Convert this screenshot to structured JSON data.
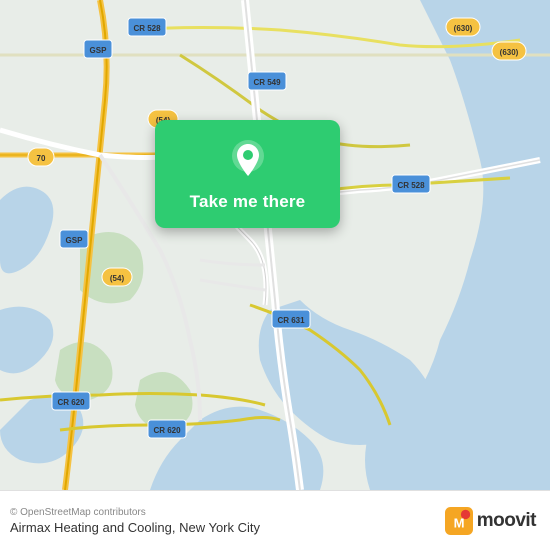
{
  "map": {
    "attribution": "© OpenStreetMap contributors",
    "background_color": "#e8f0e8"
  },
  "card": {
    "label": "Take me there",
    "background_color": "#2ecc71"
  },
  "bottom_bar": {
    "business_name": "Airmax Heating and Cooling, New York City",
    "moovit_text": "moovit"
  },
  "road_labels": [
    {
      "id": "cr528_top",
      "text": "CR 528"
    },
    {
      "id": "cr549",
      "text": "CR 549"
    },
    {
      "id": "cr630_1",
      "text": "(630)"
    },
    {
      "id": "cr630_2",
      "text": "(630)"
    },
    {
      "id": "gsp_top",
      "text": "GSP"
    },
    {
      "id": "54_top",
      "text": "(54)"
    },
    {
      "id": "70",
      "text": "70"
    },
    {
      "id": "gsp_mid",
      "text": "GSP"
    },
    {
      "id": "54_mid",
      "text": "(54)"
    },
    {
      "id": "cr528_mid",
      "text": "CR 528"
    },
    {
      "id": "cr631",
      "text": "CR 631"
    },
    {
      "id": "cr620_1",
      "text": "CR 620"
    },
    {
      "id": "cr620_2",
      "text": "CR 620"
    }
  ],
  "icons": {
    "location_pin": "location-pin-icon",
    "moovit_logo": "moovit-icon"
  }
}
